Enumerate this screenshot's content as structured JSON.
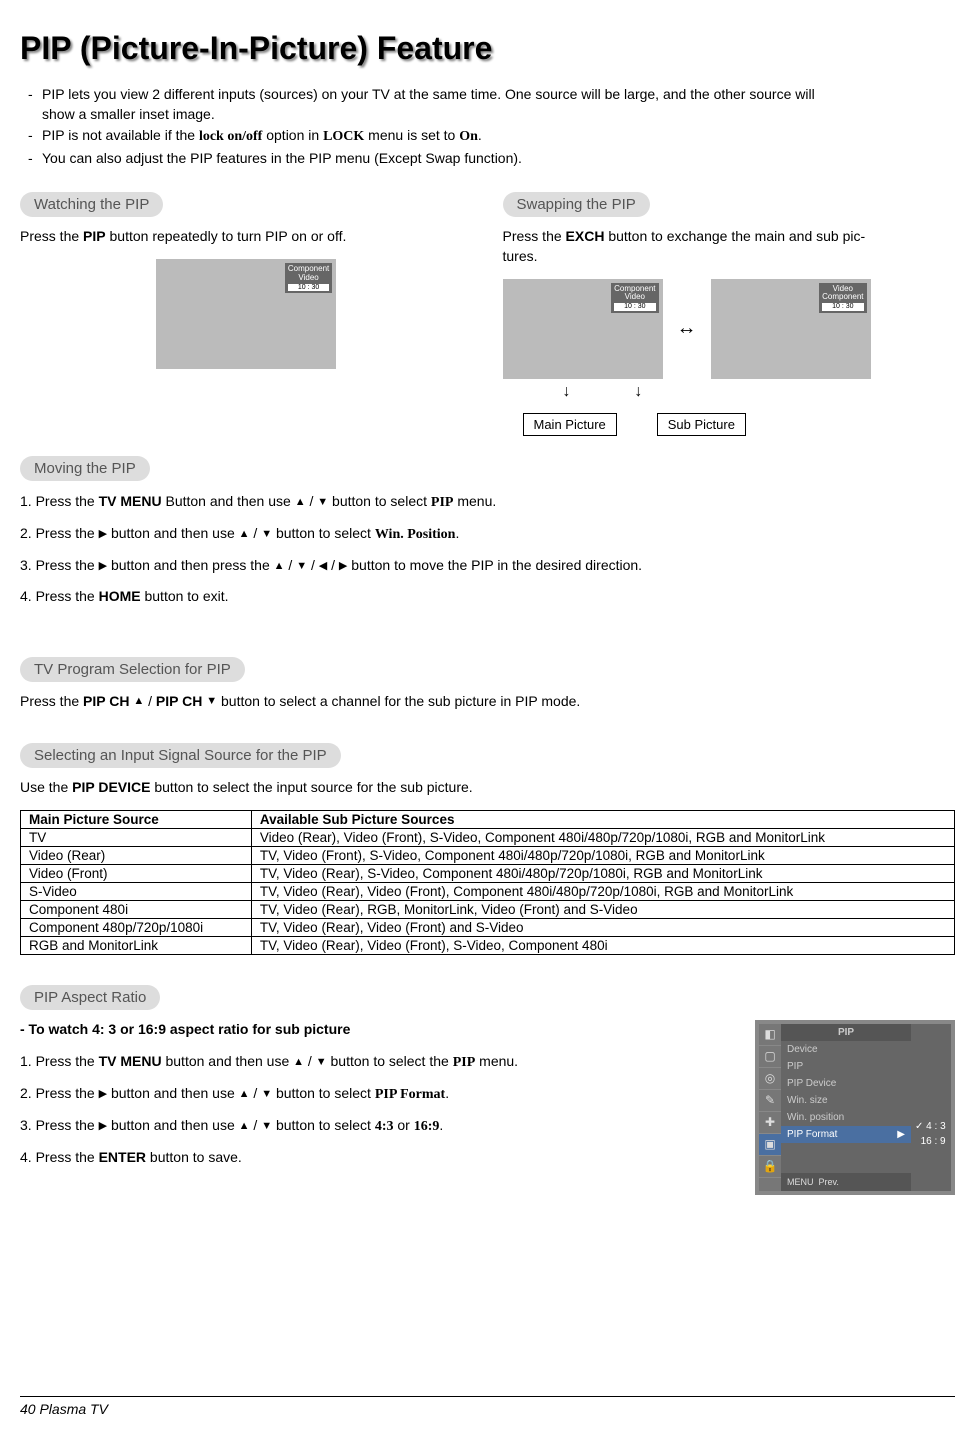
{
  "title": "PIP (Picture-In-Picture) Feature",
  "intro": {
    "l1a": "PIP lets you view 2 different inputs (sources) on your TV at the same time. One source will be large, and the other source will",
    "l1b": "show a smaller inset image.",
    "l2a": "PIP is not available if the ",
    "l2b": "lock on/off",
    "l2c": " option in ",
    "l2d": "LOCK",
    "l2e": " menu is set to ",
    "l2f": "On",
    "l2g": ".",
    "l3": "You can also adjust the PIP features in the PIP menu (Except Swap function)."
  },
  "sections": {
    "watching": "Watching the PIP",
    "swapping": "Swapping the PIP",
    "moving": "Moving the PIP",
    "tvprog": "TV Program Selection for PIP",
    "selecting": "Selecting an Input Signal Source for the PIP",
    "aspect": "PIP Aspect Ratio"
  },
  "watching_text_a": "Press the ",
  "watching_text_b": "PIP",
  "watching_text_c": " button repeatedly to turn PIP on or off.",
  "swapping_text_a": "Press the ",
  "swapping_text_b": "EXCH",
  "swapping_text_c": " button to exchange the main and sub pic-",
  "swapping_text_d": "tures.",
  "tv_overlay_comp": "Component",
  "tv_overlay_video": "Video",
  "tv_overlay_time": "10 : 30",
  "label_main": "Main Picture",
  "label_sub": "Sub Picture",
  "moving": {
    "s1a": "1. Press the ",
    "s1b": "TV MENU",
    "s1c": " Button and then use ",
    "s1d": " button to select ",
    "s1e": "PIP",
    "s1f": " menu.",
    "s2a": "2. Press the ",
    "s2b": " button and then use ",
    "s2c": " button to select ",
    "s2d": "Win. Position",
    "s2e": ".",
    "s3a": "3. Press the ",
    "s3b": " button and then press the ",
    "s3c": "  button to move the PIP in the desired direction.",
    "s4a": "4. Press the ",
    "s4b": "HOME",
    "s4c": " button to exit."
  },
  "tvprog_text_a": "Press the ",
  "tvprog_text_b": "PIP CH ",
  "tvprog_text_c": "PIP CH ",
  "tvprog_text_d": " button to select a channel for the sub picture in PIP mode.",
  "selecting_text_a": "Use the ",
  "selecting_text_b": "PIP DEVICE",
  "selecting_text_c": " button to select the input source for the sub picture.",
  "table": {
    "h1": "Main Picture Source",
    "h2": "Available Sub Picture Sources",
    "rows": [
      [
        "TV",
        "Video (Rear), Video (Front), S-Video, Component 480i/480p/720p/1080i, RGB and MonitorLink"
      ],
      [
        "Video (Rear)",
        "TV, Video (Front), S-Video, Component 480i/480p/720p/1080i, RGB and MonitorLink"
      ],
      [
        "Video (Front)",
        "TV, Video (Rear), S-Video, Component 480i/480p/720p/1080i, RGB and MonitorLink"
      ],
      [
        "S-Video",
        "TV, Video (Rear), Video (Front), Component 480i/480p/720p/1080i, RGB and MonitorLink"
      ],
      [
        "Component 480i",
        "TV, Video (Rear), RGB, MonitorLink, Video (Front) and S-Video"
      ],
      [
        "Component 480p/720p/1080i",
        "TV, Video (Rear), Video (Front) and S-Video"
      ],
      [
        "RGB and MonitorLink",
        "TV, Video (Rear), Video (Front), S-Video, Component 480i"
      ]
    ]
  },
  "aspect": {
    "heading": "-  To watch 4: 3 or 16:9 aspect ratio for sub picture",
    "s1a": "1. Press the ",
    "s1b": "TV MENU",
    "s1c": " button and then use ",
    "s1d": " button to select the ",
    "s1e": "PIP",
    "s1f": " menu.",
    "s2a": "2. Press the ",
    "s2b": " button and then use ",
    "s2c": " button to select ",
    "s2d": "PIP Format",
    "s2e": ".",
    "s3a": "3. Press the ",
    "s3b": " button and then use ",
    "s3c": " button to select ",
    "s3d": "4:3",
    "s3e": " or ",
    "s3f": "16:9",
    "s3g": ".",
    "s4a": "4. Press the ",
    "s4b": "ENTER",
    "s4c": " button to save."
  },
  "osd": {
    "title": "PIP",
    "items": [
      "Device",
      "PIP",
      "PIP Device",
      "Win. size",
      "Win. position"
    ],
    "sel": "PIP Format",
    "opt1": "4 : 3",
    "opt2": "16 : 9",
    "footer_menu": "MENU",
    "footer_prev": "Prev."
  },
  "footer_page": "40   Plasma TV"
}
